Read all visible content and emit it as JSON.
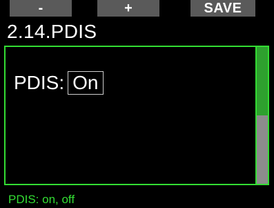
{
  "softkeys": {
    "left": "-",
    "middle": "+",
    "right": "SAVE"
  },
  "title": "2.14.PDIS",
  "setting": {
    "label": "PDIS:",
    "value": "On"
  },
  "scroll": {
    "position_fraction": 0.0,
    "visible_fraction": 0.5
  },
  "footer": {
    "hint": "PDIS: on, off"
  },
  "colors": {
    "accent": "#33dd33",
    "softkey_bg": "#5a5a5a",
    "scroll_track": "#8c8c8c",
    "scroll_thumb": "#2ea02e"
  }
}
